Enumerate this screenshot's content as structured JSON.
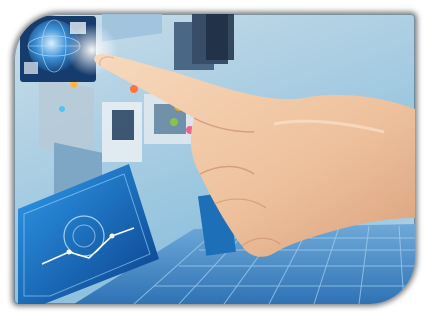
{
  "image": {
    "subject": "hand-touching-digital-screens",
    "accent_colors": {
      "sky": "#a9cde2",
      "screen_blue": "#1d6fb7",
      "skin": "#f1c9a6",
      "grid": "#4c8fc9"
    }
  }
}
